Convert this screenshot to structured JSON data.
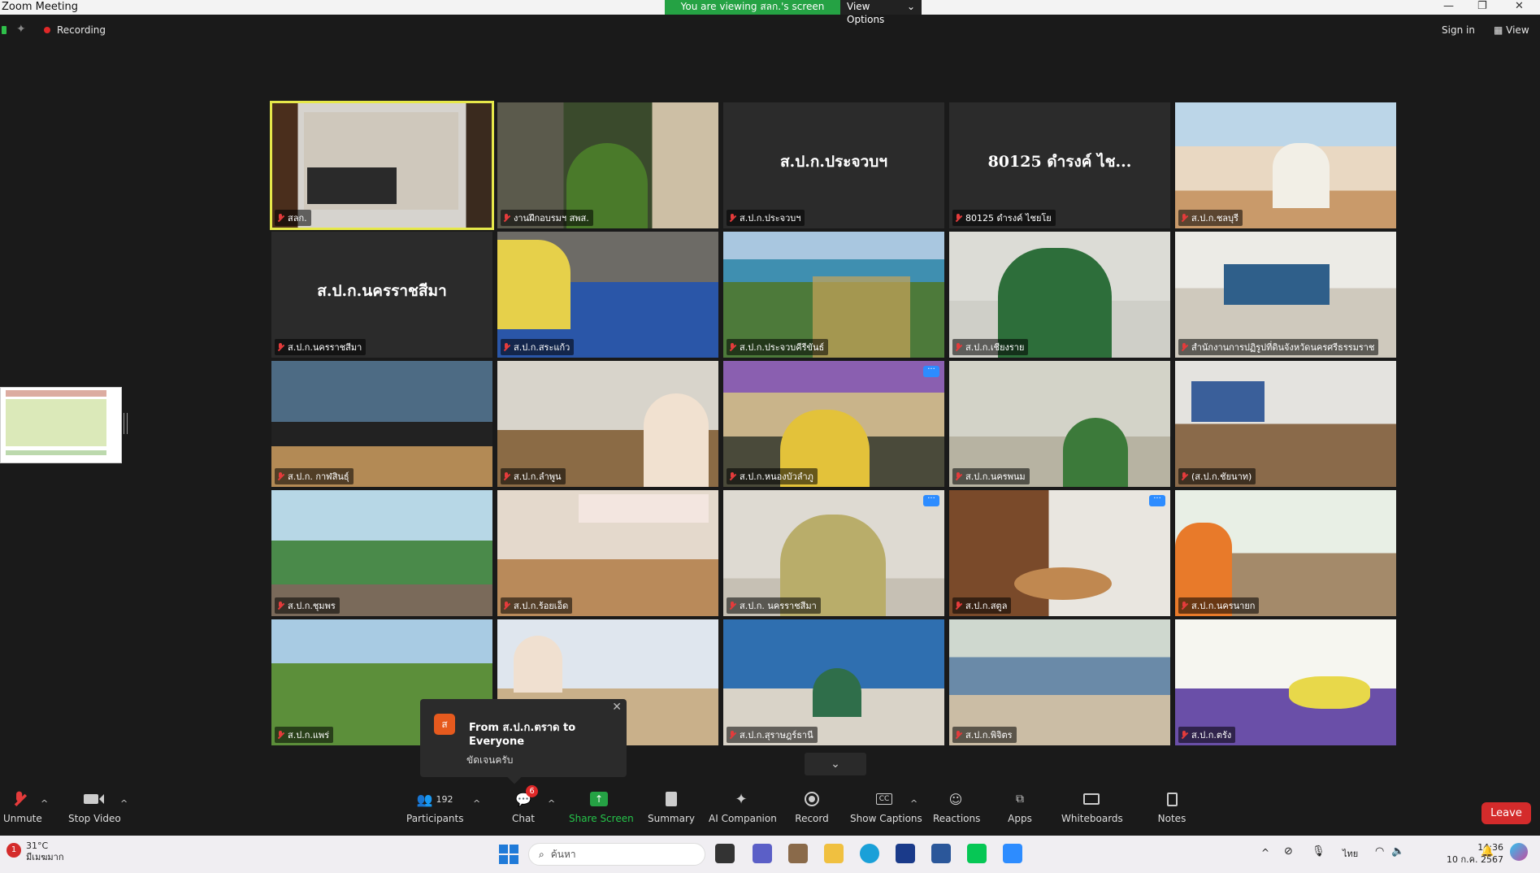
{
  "window": {
    "title": "Zoom Meeting"
  },
  "share_banner": {
    "text": "You are viewing สลก.'s screen",
    "options_label": "View Options"
  },
  "topbar": {
    "recording_label": "Recording",
    "sign_in_label": "Sign in",
    "view_label": "View"
  },
  "participants_tiles": [
    {
      "name": "สลก.",
      "active": true
    },
    {
      "name": "งานฝึกอบรมฯ สพส."
    },
    {
      "name": "ส.ป.ก.ประจวบฯ",
      "placeholder": "ส.ป.ก.ประจวบฯ"
    },
    {
      "name": "80125 ดำรงค์ ไชยโย",
      "placeholder": "80125 ดำรงค์ ไช..."
    },
    {
      "name": "ส.ป.ก.ชลบุรี"
    },
    {
      "name": "ส.ป.ก.นครราชสีมา",
      "placeholder": "ส.ป.ก.นครราชสีมา"
    },
    {
      "name": "ส.ป.ก.สระแก้ว"
    },
    {
      "name": "ส.ป.ก.ประจวบคีรีขันธ์"
    },
    {
      "name": "ส.ป.ก.เชียงราย"
    },
    {
      "name": "สำนักงานการปฏิรูปที่ดินจังหวัดนครศรีธรรมราช"
    },
    {
      "name": "ส.ป.ก. กาฬสินธุ์"
    },
    {
      "name": "ส.ป.ก.ลำพูน"
    },
    {
      "name": "ส.ป.ก.หนองบัวลำภู",
      "more": true
    },
    {
      "name": "ส.ป.ก.นครพนม"
    },
    {
      "name": "(ส.ป.ก.ชัยนาท)"
    },
    {
      "name": "ส.ป.ก.ชุมพร"
    },
    {
      "name": "ส.ป.ก.ร้อยเอ็ด"
    },
    {
      "name": "ส.ป.ก. นครราชสีมา",
      "more": true
    },
    {
      "name": "ส.ป.ก.สตูล",
      "more": true
    },
    {
      "name": "ส.ป.ก.นครนายก"
    },
    {
      "name": "ส.ป.ก.แพร่"
    },
    {
      "name": ""
    },
    {
      "name": "ส.ป.ก.สุราษฎร์ธานี"
    },
    {
      "name": "ส.ป.ก.พิจิตร"
    },
    {
      "name": "ส.ป.ก.ตรัง"
    }
  ],
  "chat_popup": {
    "avatar_letter": "ส",
    "from": "From ส.ป.ก.ตราด to Everyone",
    "message": "ขัดเจนครับ"
  },
  "toolbar": {
    "unmute": "Unmute",
    "stop_video": "Stop Video",
    "participants": "Participants",
    "participants_count": "192",
    "chat": "Chat",
    "chat_badge": "6",
    "share_screen": "Share Screen",
    "summary": "Summary",
    "ai_companion": "AI Companion",
    "record": "Record",
    "show_captions": "Show Captions",
    "reactions": "Reactions",
    "apps": "Apps",
    "whiteboards": "Whiteboards",
    "notes": "Notes",
    "leave": "Leave"
  },
  "taskbar": {
    "temperature": "31°C",
    "weather_text": "มีเมฆมาก",
    "search_placeholder": "ค้นหา",
    "language": "ไทย",
    "time": "14:36",
    "date": "10 ก.ค. 2567"
  },
  "colors": {
    "share_green": "#25a244",
    "leave_red": "#d42b2b",
    "active_border": "#e6e84a",
    "zoom_blue": "#2d8cff"
  }
}
